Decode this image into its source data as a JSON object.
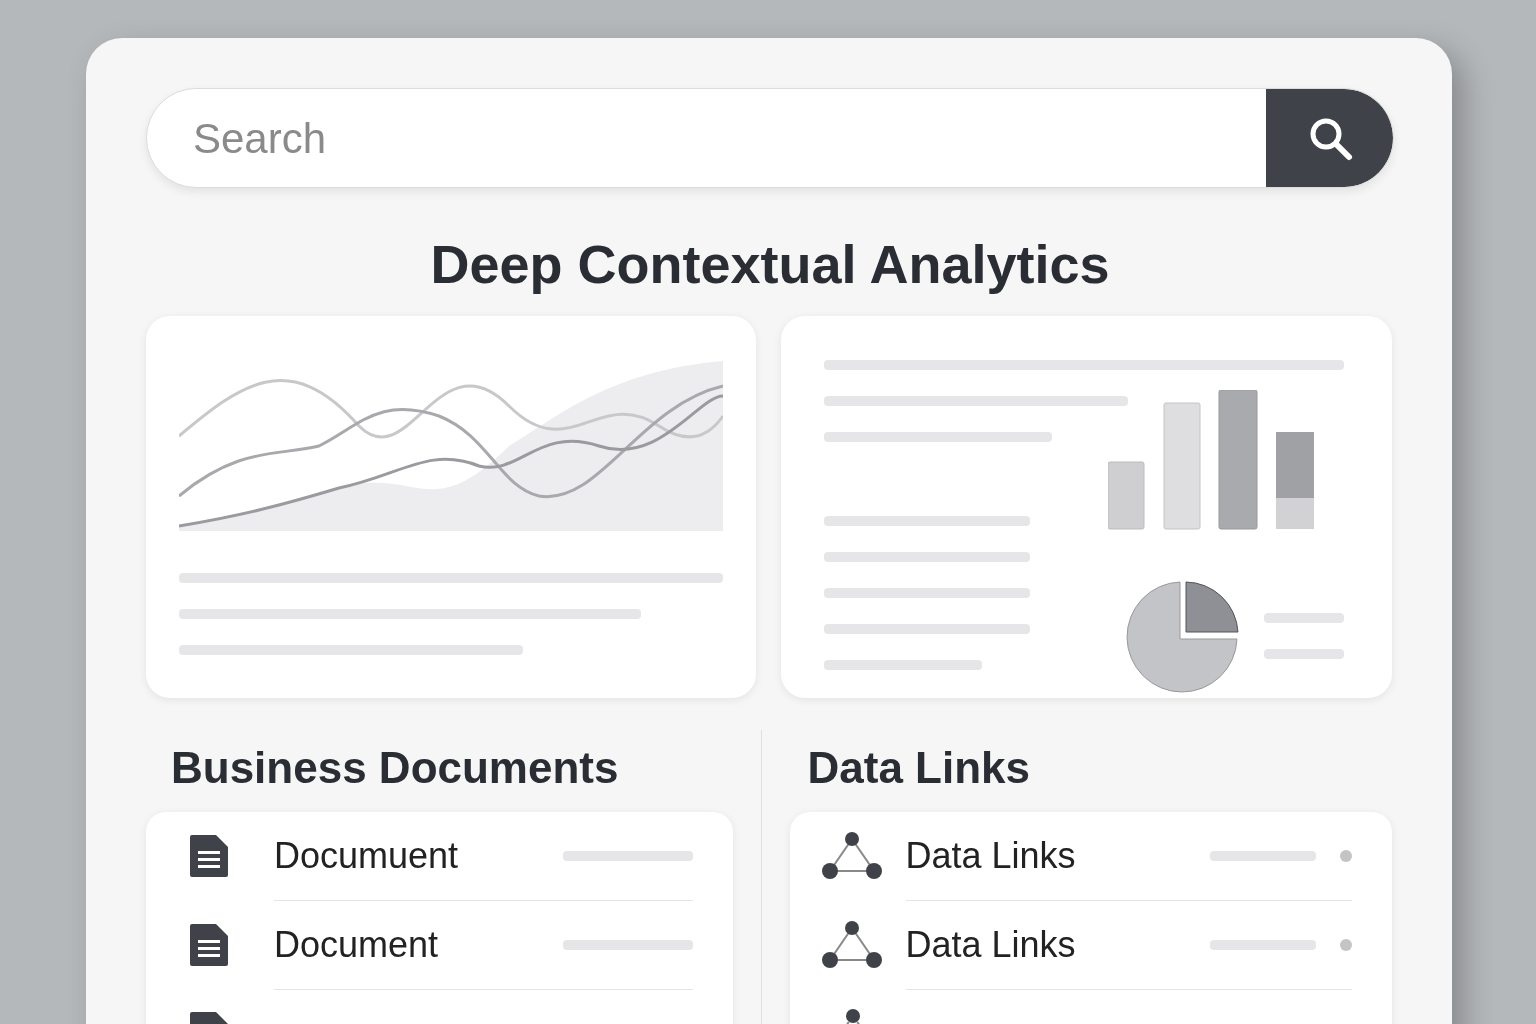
{
  "search": {
    "placeholder": "Search"
  },
  "title": "Deep Contextual Analytics",
  "documents": {
    "heading": "Business Documents",
    "items": [
      {
        "label": "Documuent"
      },
      {
        "label": "Document"
      }
    ]
  },
  "data_links": {
    "heading": "Data Links",
    "items": [
      {
        "label": "Data Links"
      },
      {
        "label": "Data Links"
      }
    ]
  }
}
